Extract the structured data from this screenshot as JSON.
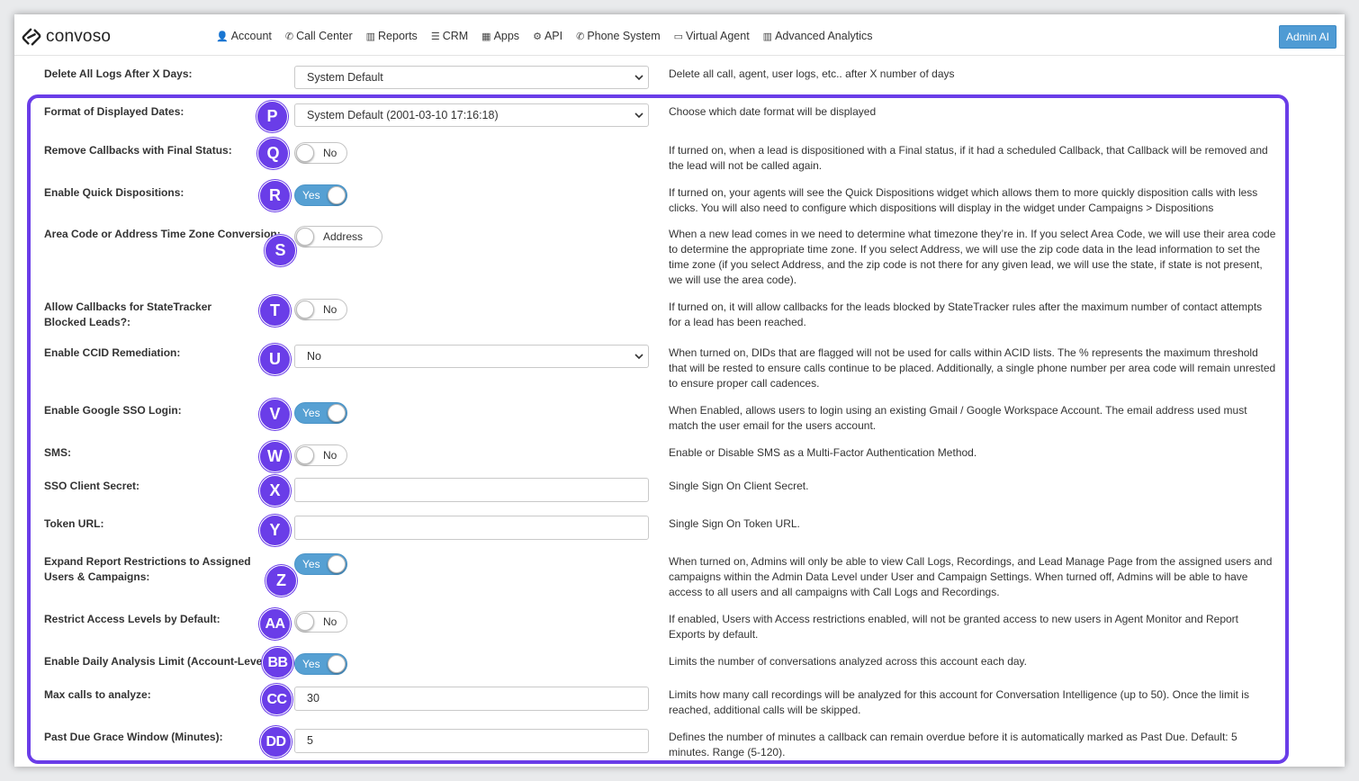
{
  "brand": {
    "name": "convoso"
  },
  "nav": [
    {
      "icon": "user-icon",
      "glyph": "👤",
      "label": "Account"
    },
    {
      "icon": "phone-icon",
      "glyph": "✆",
      "label": "Call Center"
    },
    {
      "icon": "bar-chart-icon",
      "glyph": "▥",
      "label": "Reports"
    },
    {
      "icon": "list-icon",
      "glyph": "☰",
      "label": "CRM"
    },
    {
      "icon": "grid-icon",
      "glyph": "▦",
      "label": "Apps"
    },
    {
      "icon": "gear-icon",
      "glyph": "⚙",
      "label": "API"
    },
    {
      "icon": "phone-icon",
      "glyph": "✆",
      "label": "Phone System"
    },
    {
      "icon": "monitor-icon",
      "glyph": "▭",
      "label": "Virtual Agent"
    },
    {
      "icon": "bar-chart-icon",
      "glyph": "▥",
      "label": "Advanced Analytics"
    }
  ],
  "admin_button": "Admin AI",
  "settings": {
    "delete_logs": {
      "label": "Delete All Logs After X Days:",
      "value": "System Default",
      "desc": "Delete all call, agent, user logs, etc.. after X number of days"
    },
    "date_format": {
      "marker": "P",
      "label": "Format of Displayed Dates:",
      "value": "System Default (2001-03-10 17:16:18)",
      "desc": "Choose which date format will be displayed"
    },
    "remove_callbacks": {
      "marker": "Q",
      "label": "Remove Callbacks with Final Status:",
      "value": "No",
      "desc": "If turned on, when a lead is dispositioned with a Final status, if it had a scheduled Callback, that Callback will be removed and the lead will not be called again."
    },
    "quick_dispositions": {
      "marker": "R",
      "label": "Enable Quick Dispositions:",
      "value": "Yes",
      "desc": "If turned on, your agents will see the Quick Dispositions widget which allows them to more quickly disposition calls with less clicks. You will also need to configure which dispositions will display in the widget under Campaigns > Dispositions"
    },
    "timezone_conversion": {
      "marker": "S",
      "label": "Area Code or Address Time Zone Conversion:",
      "value": "Address",
      "desc": "When a new lead comes in we need to determine what timezone they’re in. If you select Area Code, we will use their area code to determine the appropriate time zone. If you select Address, we will use the zip code data in the lead information to set the time zone (if you select Address, and the zip code is not there for any given lead, we will use the state, if state is not present, we will use the area code)."
    },
    "statetracker_callbacks": {
      "marker": "T",
      "label": "Allow Callbacks for StateTracker Blocked Leads?:",
      "value": "No",
      "desc": "If turned on, it will allow callbacks for the leads blocked by StateTracker rules after the maximum number of contact attempts for a lead has been reached."
    },
    "ccid_remediation": {
      "marker": "U",
      "label": "Enable CCID Remediation:",
      "value": "No",
      "desc": "When turned on, DIDs that are flagged will not be used for calls within ACID lists. The % represents the maximum threshold that will be rested to ensure calls continue to be placed. Additionally, a single phone number per area code will remain unrested to ensure proper call cadences."
    },
    "google_sso": {
      "marker": "V",
      "label": "Enable Google SSO Login:",
      "value": "Yes",
      "desc": "When Enabled, allows users to login using an existing Gmail / Google Workspace Account. The email address used must match the user email for the users account."
    },
    "sms": {
      "marker": "W",
      "label": "SMS:",
      "value": "No",
      "desc": "Enable or Disable SMS as a Multi-Factor Authentication Method."
    },
    "sso_client_secret": {
      "marker": "X",
      "label": "SSO Client Secret:",
      "value": "",
      "desc": "Single Sign On Client Secret."
    },
    "token_url": {
      "marker": "Y",
      "label": "Token URL:",
      "value": "",
      "desc": "Single Sign On Token URL."
    },
    "report_restrictions": {
      "marker": "Z",
      "label": "Expand Report Restrictions to Assigned Users & Campaigns:",
      "value": "Yes",
      "desc": "When turned on, Admins will only be able to view Call Logs, Recordings, and Lead Manage Page from the assigned users and campaigns within the Admin Data Level under User and Campaign Settings. When turned off, Admins will be able to have access to all users and all campaigns with Call Logs and Recordings."
    },
    "restrict_access": {
      "marker": "AA",
      "label": "Restrict Access Levels by Default:",
      "value": "No",
      "desc": "If enabled, Users with Access restrictions enabled, will not be granted access to new users in Agent Monitor and Report Exports by default."
    },
    "daily_analysis": {
      "marker": "BB",
      "label": "Enable Daily Analysis Limit (Account-Level):",
      "value": "Yes",
      "desc": "Limits the number of conversations analyzed across this account each day."
    },
    "max_calls": {
      "marker": "CC",
      "label": "Max calls to analyze:",
      "value": "30",
      "desc": "Limits how many call recordings will be analyzed for this account for Conversation Intelligence (up to 50). Once the limit is reached, additional calls will be skipped."
    },
    "grace_window": {
      "marker": "DD",
      "label": "Past Due Grace Window (Minutes):",
      "value": "5",
      "desc": "Defines the number of minutes a callback can remain overdue before it is automatically marked as Past Due. Default: 5 minutes. Range (5-120)."
    }
  },
  "colors": {
    "accent": "#6a3de8",
    "toggle_on": "#56a0d3",
    "admin_button": "#4f9bd4"
  }
}
